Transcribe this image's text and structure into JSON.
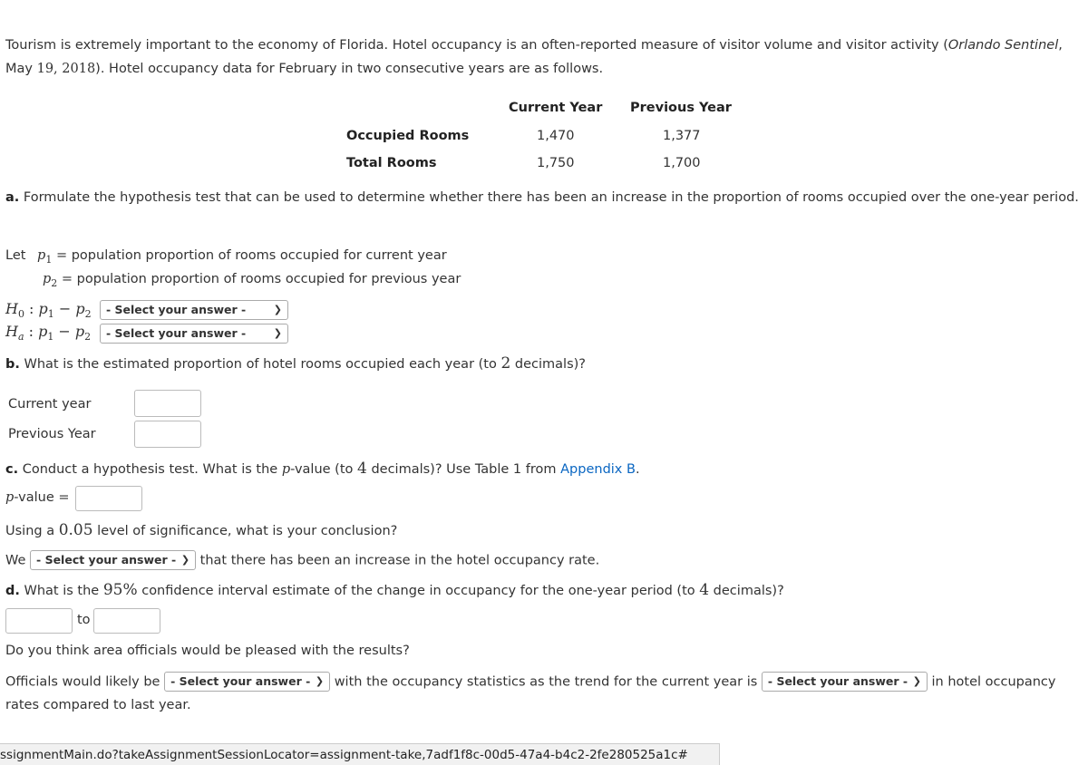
{
  "intro": {
    "text1": "Tourism is extremely important to the economy of Florida. Hotel occupancy is an often-reported measure of visitor volume and visitor activity (",
    "source": "Orlando Sentinel",
    "text2": ",",
    "date_month": "May ",
    "date_nums": "19, 2018",
    "text3": "). Hotel occupancy data for February in two consecutive years are as follows."
  },
  "table": {
    "headers": [
      "Current Year",
      "Previous Year"
    ],
    "rows": [
      {
        "label": "Occupied Rooms",
        "current": "1,470",
        "previous": "1,377"
      },
      {
        "label": "Total Rooms",
        "current": "1,750",
        "previous": "1,700"
      }
    ]
  },
  "part_a": {
    "label": "a.",
    "question": " Formulate the hypothesis test that can be used to determine whether there has been an increase in the proportion of rooms occupied over the one-year",
    "question_cont": "period.",
    "let": "Let",
    "p1": "p",
    "p1_sub": "1",
    "p2": "p",
    "p2_sub": "2",
    "eq": " = ",
    "p1_def": "population proportion of rooms occupied for current year",
    "p2_def": "population proportion of rooms occupied for previous year",
    "h0": "H",
    "h0_sub": "0",
    "ha": "H",
    "ha_sub": "a",
    "expr_colon": " : ",
    "minus": " − ",
    "h0_select": "- Select your answer -",
    "ha_select": "- Select your answer -"
  },
  "part_b": {
    "label": "b.",
    "question_pre": " What is the estimated proportion of hotel rooms occupied each year (to ",
    "decimals": "2",
    "question_post": " decimals)?",
    "current_label": "Current year",
    "previous_label": "Previous Year",
    "current_value": "",
    "previous_value": ""
  },
  "part_c": {
    "label": "c.",
    "question_pre": " Conduct a hypothesis test. What is the ",
    "p": "p",
    "question_mid": "-value (to ",
    "decimals": "4",
    "question_post": " decimals)? Use Table 1 from ",
    "link": "Appendix B",
    "period": ".",
    "pvalue_label_p": "p",
    "pvalue_label": "-value = ",
    "pvalue": "",
    "sig_pre": "Using a ",
    "sig": "0.05",
    "sig_post": " level of significance, what is your conclusion?",
    "we": "We",
    "we_select": "- Select your answer -",
    "we_post": "that there has been an increase in the hotel occupancy rate."
  },
  "part_d": {
    "label": "d.",
    "question_pre": " What is the ",
    "conf": "95%",
    "question_mid": " confidence interval estimate of the change in occupancy for the one-year period (to ",
    "decimals": "4",
    "question_post": " decimals)?",
    "lower": "",
    "to": "to",
    "upper": "",
    "followup": "Do you think area officials would be pleased with the results?",
    "officials_pre": "Officials would likely be",
    "officials_select": "- Select your answer -",
    "officials_mid": "with the occupancy statistics as the trend for the current year is",
    "trend_select": "- Select your answer -",
    "officials_post": "in hotel occupancy",
    "officials_cont": "rates compared to last year."
  },
  "status_bar": {
    "url": "ssignmentMain.do?takeAssignmentSessionLocator=assignment-take,7adf1f8c-00d5-47a4-b4c2-2fe280525a1c#"
  }
}
